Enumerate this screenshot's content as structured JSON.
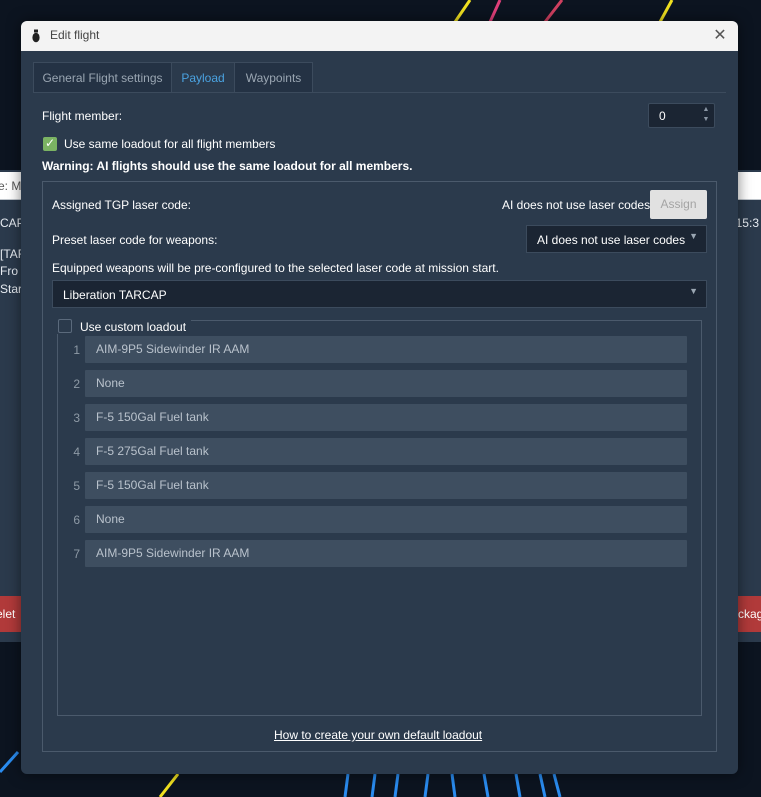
{
  "background": {
    "header_fragment": "e: M",
    "left_lines": [
      "CAP",
      "[TAF",
      "Fro",
      "Star"
    ],
    "right_time": "4:15:3",
    "left_button": "elet",
    "right_button": "ckag"
  },
  "dialog": {
    "title": "Edit flight",
    "close_glyph": "✕"
  },
  "tabs": [
    {
      "label": "General Flight settings"
    },
    {
      "label": "Payload"
    },
    {
      "label": "Waypoints"
    }
  ],
  "payload": {
    "flight_member_label": "Flight member:",
    "flight_member_value": "0",
    "same_loadout_label": "Use same loadout for all flight members",
    "same_loadout_checked": true,
    "warning": "Warning: AI flights should use the same loadout for all members.",
    "tgp_label": "Assigned TGP laser code:",
    "tgp_status": "AI does not use laser codes",
    "assign_button": "Assign",
    "preset_label": "Preset laser code for weapons:",
    "preset_value": "AI does not use laser codes",
    "equipped_note": "Equipped weapons will be pre-configured to the selected laser code at mission start.",
    "loadout_value": "Liberation TARCAP",
    "custom_loadout_label": "Use custom loadout",
    "custom_loadout_checked": false,
    "slots": [
      {
        "num": "1",
        "weapon": "AIM-9P5 Sidewinder IR AAM"
      },
      {
        "num": "2",
        "weapon": "None"
      },
      {
        "num": "3",
        "weapon": "F-5 150Gal Fuel tank"
      },
      {
        "num": "4",
        "weapon": "F-5 275Gal Fuel tank"
      },
      {
        "num": "5",
        "weapon": "F-5 150Gal Fuel tank"
      },
      {
        "num": "6",
        "weapon": "None"
      },
      {
        "num": "7",
        "weapon": "AIM-9P5 Sidewinder IR AAM"
      }
    ],
    "help_link": "How to create your own default loadout"
  },
  "colors": {
    "dialog_bg": "#2b3a4c",
    "accent_tab": "#4aa2e0",
    "checkbox": "#7bb363",
    "slot_bg": "#3e4e60",
    "danger": "#b13a3a"
  },
  "icons": {
    "title": "bomb-icon",
    "close": "close-icon",
    "combo": "chevron-down-icon",
    "spin": "spin-arrows-icon",
    "check": "checkmark-icon"
  }
}
